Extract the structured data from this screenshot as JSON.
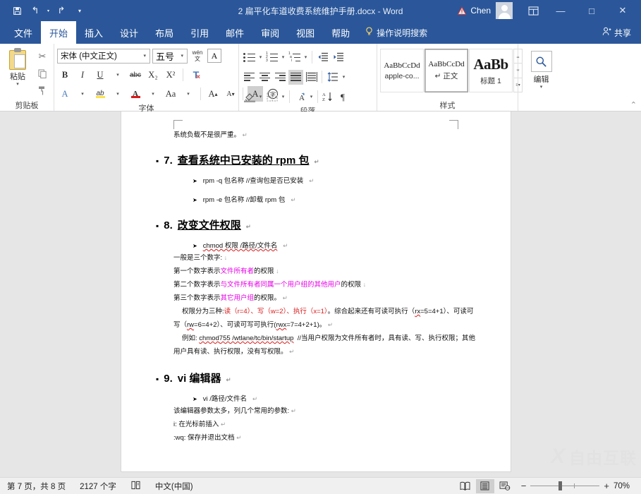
{
  "titlebar": {
    "save_icon": "save-icon",
    "undo_icon": "undo-icon",
    "redo_icon": "redo-icon",
    "customize_icon": "customize-qat-icon",
    "document_title": "2 扁平化车道收费系统维护手册.docx  -  Word",
    "warning_icon": "warning-icon",
    "user_name": "Chen",
    "avatar": "user-avatar",
    "ribbon_display_icon": "ribbon-display-options-icon",
    "minimize": "—",
    "maximize": "□",
    "close": "✕"
  },
  "tabs": [
    {
      "label": "文件",
      "active": false
    },
    {
      "label": "开始",
      "active": true
    },
    {
      "label": "插入",
      "active": false
    },
    {
      "label": "设计",
      "active": false
    },
    {
      "label": "布局",
      "active": false
    },
    {
      "label": "引用",
      "active": false
    },
    {
      "label": "邮件",
      "active": false
    },
    {
      "label": "审阅",
      "active": false
    },
    {
      "label": "视图",
      "active": false
    },
    {
      "label": "帮助",
      "active": false
    }
  ],
  "tellme": {
    "icon": "lightbulb-icon",
    "label": "操作说明搜索"
  },
  "share": {
    "icon": "share-person-icon",
    "label": "共享"
  },
  "ribbon": {
    "clipboard": {
      "group_label": "剪贴板",
      "paste_label": "粘贴",
      "paste_icon": "paste-icon",
      "cut_icon": "scissors-icon",
      "copy_icon": "copy-icon",
      "format_painter_icon": "format-painter-icon",
      "launcher": "◢"
    },
    "font": {
      "group_label": "字体",
      "font_name": "宋体 (中文正文)",
      "font_size": "五号",
      "phonetic_guide_icon": "phonetic-guide-icon",
      "char_border_icon": "character-border-icon",
      "bold": "B",
      "italic": "I",
      "underline": "U",
      "strikethrough": "abc",
      "subscript": "X₂",
      "superscript": "X²",
      "clear_format_icon": "clear-formatting-icon",
      "text_effects_icon": "text-effects-icon",
      "highlight_icon": "text-highlight-icon",
      "font_color_icon": "font-color-icon",
      "change_case": "Aa",
      "grow_font": "A",
      "shrink_font": "A",
      "char_shading_icon": "character-shading-icon",
      "enclose_char_icon": "enclose-character-icon",
      "launcher": "◢"
    },
    "paragraph": {
      "group_label": "段落",
      "bullets_icon": "bullet-list-icon",
      "numbering_icon": "numbered-list-icon",
      "multilevel_icon": "multilevel-list-icon",
      "decrease_indent_icon": "decrease-indent-icon",
      "increase_indent_icon": "increase-indent-icon",
      "align_left_icon": "align-left-icon",
      "align_center_icon": "align-center-icon",
      "align_right_icon": "align-right-icon",
      "justify_icon": "justify-icon",
      "distribute_icon": "distribute-icon",
      "line_spacing_icon": "line-spacing-icon",
      "shading_icon": "shading-icon",
      "borders_icon": "borders-icon",
      "asian_layout_icon": "asian-layout-icon",
      "sort_icon": "sort-icon",
      "show_marks_icon": "show-paragraph-marks-icon",
      "launcher": "◢"
    },
    "styles": {
      "group_label": "样式",
      "items": [
        {
          "preview": "AaBbCcDd",
          "name": "apple-co...",
          "selected": false
        },
        {
          "preview": "AaBbCcDd",
          "name": "↵ 正文",
          "selected": true
        },
        {
          "preview": "AaBb",
          "name": "标题 1",
          "selected": false
        }
      ],
      "nav_up": "▴",
      "nav_down": "▾",
      "nav_more": "▾",
      "launcher": "◢"
    },
    "editing": {
      "group_label": "编辑",
      "icon": "search-magnifier-icon",
      "caret": "▾"
    },
    "collapse_icon": "collapse-ribbon-icon"
  },
  "document": {
    "line_top": "系统负载不是很严重。",
    "heading7": {
      "bullet": "▪",
      "num": "7.",
      "text": "查看系统中已安装的 rpm 包"
    },
    "rpm_lines": [
      "rpm -q  包名称  //查询包是否已安装",
      "rpm -e  包名称  //卸载 rpm 包"
    ],
    "heading8": {
      "bullet": "▪",
      "num": "8.",
      "text": "改变文件权限"
    },
    "chmod_line": "chmod 权限 /路径/文件名",
    "perm_intro": "一般是三个数字:",
    "perm1_pre": "第一个数字表示",
    "perm1_hl": "文件所有者",
    "perm1_post": "的权限",
    "perm2_pre": "第二个数字表示",
    "perm2_hl": "与文件所有者同属一个用户组的其他用户",
    "perm2_post": "的权限",
    "perm3_pre": "第三个数字表示",
    "perm3_hl": "其它用户组",
    "perm3_post": "的权限。",
    "kinds_pre": "权限分为三种:",
    "kinds_hl": "读（r=4）、写（w=2）、执行（x=1）",
    "kinds_post": "。综合起来还有可读可执行（",
    "kinds_rx": "rx",
    "kinds_mid": "=5=4+1）、可读可写（",
    "kinds_rw": "rw",
    "kinds_mid2": "=6=4+2）、可读可写可执行(",
    "kinds_rwx": "rwx",
    "kinds_end": "=7=4+2+1)。",
    "example_pre": "例如:",
    "example_cmd": "chmod",
    "example_args": "755 /wtlane/tc/bin/startup",
    "example_comment": "//当用户权限为文件所有者时，具有读、写、执行",
    "example_line2": "权限；其他用户具有读、执行权限，没有写权限。",
    "heading9": {
      "bullet": "▪",
      "num": "9.",
      "text": "vi 编辑器"
    },
    "vi_line": "vi /路径/文件名",
    "vi_note": "该编辑器参数太多，列几个常用的参数:",
    "vi_i": "i: 在光标前插入",
    "vi_wq": ":wq: 保存并退出文档",
    "paragraph_mark": "↵",
    "line_break_mark": "↓"
  },
  "watermark": {
    "logo": "X",
    "text": "自由互联"
  },
  "statusbar": {
    "page_info": "第 7 页，共 8 页",
    "word_count": "2127 个字",
    "proofing_icon": "proofing-errors-icon",
    "language": "中文(中国)",
    "view_read_icon": "read-mode-icon",
    "view_print_icon": "print-layout-icon",
    "view_web_icon": "web-layout-icon",
    "zoom_out": "−",
    "zoom_in": "+",
    "zoom_level": "70%"
  }
}
